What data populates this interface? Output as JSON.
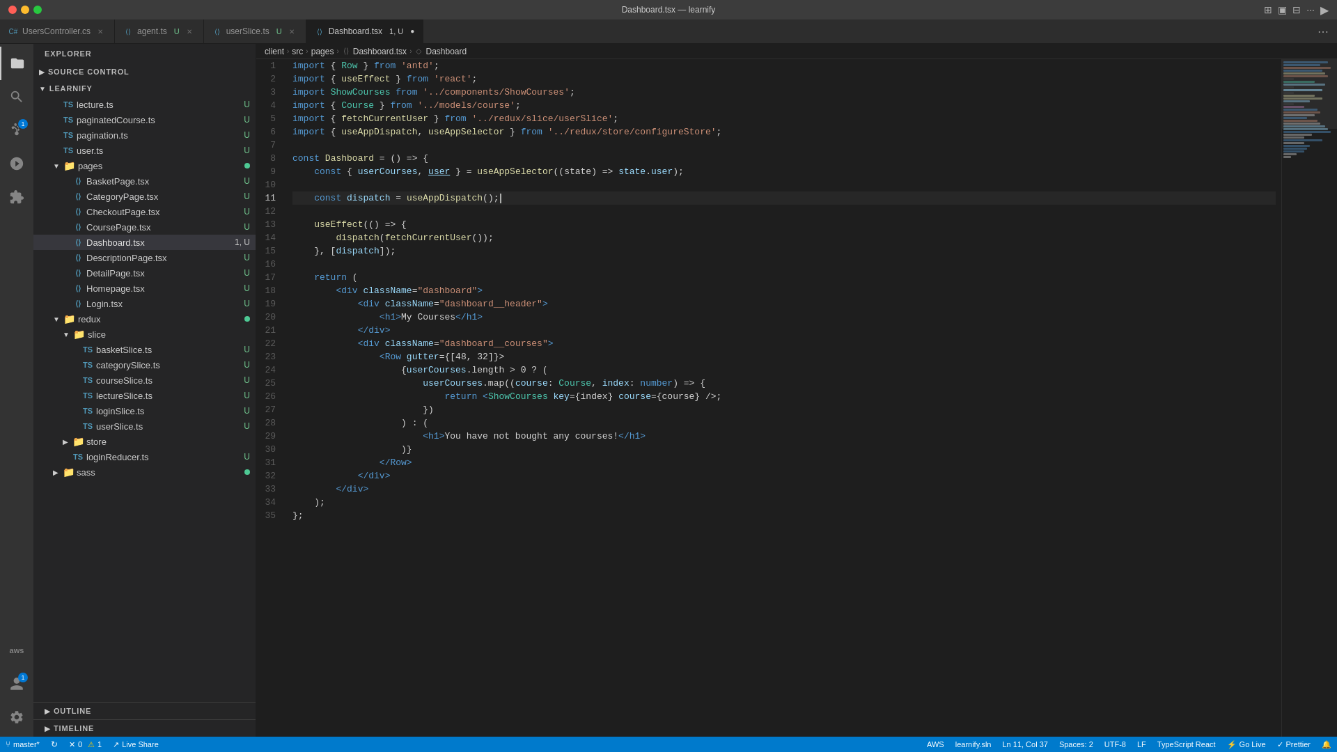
{
  "titlebar": {
    "title": "Dashboard.tsx — learnify",
    "buttons": {
      "close": "●",
      "min": "●",
      "max": "●"
    }
  },
  "tabs": [
    {
      "id": "users-controller",
      "label": "UsersController.cs",
      "icon": "C#",
      "iconColor": "blue",
      "modified": false,
      "active": false
    },
    {
      "id": "agent-ts",
      "label": "agent.ts",
      "icon": "TS",
      "iconColor": "blue",
      "modified": true,
      "badge": "U",
      "active": false
    },
    {
      "id": "user-slice-ts",
      "label": "userSlice.ts",
      "icon": "TS",
      "iconColor": "blue",
      "modified": true,
      "badge": "U",
      "active": false
    },
    {
      "id": "dashboard-tsx",
      "label": "Dashboard.tsx",
      "icon": "TSX",
      "iconColor": "blue",
      "modified": true,
      "badge": "1, U",
      "active": true
    }
  ],
  "breadcrumb": {
    "items": [
      "client",
      "src",
      "pages",
      "Dashboard.tsx",
      "Dashboard"
    ]
  },
  "sidebar": {
    "title": "EXPLORER",
    "sections": {
      "sourceControl": {
        "label": "SOURCE CONTROL",
        "expanded": false
      },
      "learnify": {
        "label": "LEARNIFY",
        "expanded": true
      }
    },
    "files": [
      {
        "name": "lecture.ts",
        "indent": 2,
        "modified": "U",
        "type": "ts"
      },
      {
        "name": "paginatedCourse.ts",
        "indent": 2,
        "modified": "U",
        "type": "ts"
      },
      {
        "name": "pagination.ts",
        "indent": 2,
        "modified": "U",
        "type": "ts"
      },
      {
        "name": "user.ts",
        "indent": 2,
        "modified": "U",
        "type": "ts"
      },
      {
        "name": "pages",
        "indent": 1,
        "type": "folder",
        "expanded": true,
        "dotColor": true
      },
      {
        "name": "BasketPage.tsx",
        "indent": 3,
        "modified": "U",
        "type": "ts"
      },
      {
        "name": "CategoryPage.tsx",
        "indent": 3,
        "modified": "U",
        "type": "ts"
      },
      {
        "name": "CheckoutPage.tsx",
        "indent": 3,
        "modified": "U",
        "type": "ts"
      },
      {
        "name": "CoursePage.tsx",
        "indent": 3,
        "modified": "U",
        "type": "ts"
      },
      {
        "name": "Dashboard.tsx",
        "indent": 3,
        "modified": "1, U",
        "type": "ts",
        "active": true
      },
      {
        "name": "DescriptionPage.tsx",
        "indent": 3,
        "modified": "U",
        "type": "ts"
      },
      {
        "name": "DetailPage.tsx",
        "indent": 3,
        "modified": "U",
        "type": "ts"
      },
      {
        "name": "Homepage.tsx",
        "indent": 3,
        "modified": "U",
        "type": "ts"
      },
      {
        "name": "Login.tsx",
        "indent": 3,
        "modified": "U",
        "type": "ts"
      },
      {
        "name": "redux",
        "indent": 1,
        "type": "folder",
        "expanded": true,
        "dotColor": true
      },
      {
        "name": "slice",
        "indent": 2,
        "type": "folder",
        "expanded": true
      },
      {
        "name": "basketSlice.ts",
        "indent": 4,
        "modified": "U",
        "type": "ts"
      },
      {
        "name": "categorySlice.ts",
        "indent": 4,
        "modified": "U",
        "type": "ts"
      },
      {
        "name": "courseSlice.ts",
        "indent": 4,
        "modified": "U",
        "type": "ts"
      },
      {
        "name": "lectureSlice.ts",
        "indent": 4,
        "modified": "U",
        "type": "ts"
      },
      {
        "name": "loginSlice.ts",
        "indent": 4,
        "modified": "U",
        "type": "ts"
      },
      {
        "name": "userSlice.ts",
        "indent": 4,
        "modified": "U",
        "type": "ts"
      },
      {
        "name": "store",
        "indent": 2,
        "type": "folder",
        "expanded": false
      },
      {
        "name": "loginReducer.ts",
        "indent": 3,
        "modified": "U",
        "type": "ts"
      },
      {
        "name": "sass",
        "indent": 1,
        "type": "folder",
        "expanded": false,
        "dotColor": true
      }
    ],
    "outline": {
      "label": "OUTLINE",
      "expanded": false
    },
    "timeline": {
      "label": "TIMELINE",
      "expanded": false
    }
  },
  "editor": {
    "filename": "Dashboard.tsx",
    "lines": [
      {
        "num": 1,
        "tokens": [
          {
            "t": "import",
            "c": "kw"
          },
          {
            "t": " { ",
            "c": "plain"
          },
          {
            "t": "Row",
            "c": "cls"
          },
          {
            "t": " } ",
            "c": "plain"
          },
          {
            "t": "from",
            "c": "kw"
          },
          {
            "t": " ",
            "c": "plain"
          },
          {
            "t": "'antd'",
            "c": "str"
          },
          {
            "t": ";",
            "c": "punc"
          }
        ]
      },
      {
        "num": 2,
        "tokens": [
          {
            "t": "import",
            "c": "kw"
          },
          {
            "t": " { ",
            "c": "plain"
          },
          {
            "t": "useEffect",
            "c": "fn"
          },
          {
            "t": " } ",
            "c": "plain"
          },
          {
            "t": "from",
            "c": "kw"
          },
          {
            "t": " ",
            "c": "plain"
          },
          {
            "t": "'react'",
            "c": "str"
          },
          {
            "t": ";",
            "c": "punc"
          }
        ]
      },
      {
        "num": 3,
        "tokens": [
          {
            "t": "import",
            "c": "kw"
          },
          {
            "t": " ",
            "c": "plain"
          },
          {
            "t": "ShowCourses",
            "c": "cls"
          },
          {
            "t": " ",
            "c": "plain"
          },
          {
            "t": "from",
            "c": "kw"
          },
          {
            "t": " ",
            "c": "plain"
          },
          {
            "t": "'../components/ShowCourses'",
            "c": "str"
          },
          {
            "t": ";",
            "c": "punc"
          }
        ]
      },
      {
        "num": 4,
        "tokens": [
          {
            "t": "import",
            "c": "kw"
          },
          {
            "t": " { ",
            "c": "plain"
          },
          {
            "t": "Course",
            "c": "cls"
          },
          {
            "t": " } ",
            "c": "plain"
          },
          {
            "t": "from",
            "c": "kw"
          },
          {
            "t": " ",
            "c": "plain"
          },
          {
            "t": "'../models/course'",
            "c": "str"
          },
          {
            "t": ";",
            "c": "punc"
          }
        ]
      },
      {
        "num": 5,
        "tokens": [
          {
            "t": "import",
            "c": "kw"
          },
          {
            "t": " { ",
            "c": "plain"
          },
          {
            "t": "fetchCurrentUser",
            "c": "fn"
          },
          {
            "t": " } ",
            "c": "plain"
          },
          {
            "t": "from",
            "c": "kw"
          },
          {
            "t": " ",
            "c": "plain"
          },
          {
            "t": "'../redux/slice/userSlice'",
            "c": "str"
          },
          {
            "t": ";",
            "c": "punc"
          }
        ]
      },
      {
        "num": 6,
        "tokens": [
          {
            "t": "import",
            "c": "kw"
          },
          {
            "t": " { ",
            "c": "plain"
          },
          {
            "t": "useAppDispatch",
            "c": "fn"
          },
          {
            "t": ", ",
            "c": "plain"
          },
          {
            "t": "useAppSelector",
            "c": "fn"
          },
          {
            "t": " } ",
            "c": "plain"
          },
          {
            "t": "from",
            "c": "kw"
          },
          {
            "t": " ",
            "c": "plain"
          },
          {
            "t": "'../redux/store/configureStore'",
            "c": "str"
          },
          {
            "t": ";",
            "c": "punc"
          }
        ]
      },
      {
        "num": 7,
        "tokens": []
      },
      {
        "num": 8,
        "tokens": [
          {
            "t": "const",
            "c": "kw"
          },
          {
            "t": " ",
            "c": "plain"
          },
          {
            "t": "Dashboard",
            "c": "fn"
          },
          {
            "t": " = () => {",
            "c": "plain"
          }
        ]
      },
      {
        "num": 9,
        "tokens": [
          {
            "t": "    ",
            "c": "plain"
          },
          {
            "t": "const",
            "c": "kw"
          },
          {
            "t": " { ",
            "c": "plain"
          },
          {
            "t": "userCourses",
            "c": "var"
          },
          {
            "t": ", ",
            "c": "plain"
          },
          {
            "t": "user",
            "c": "var underline"
          },
          {
            "t": " } = ",
            "c": "plain"
          },
          {
            "t": "useAppSelector",
            "c": "fn"
          },
          {
            "t": "((state) => ",
            "c": "plain"
          },
          {
            "t": "state",
            "c": "var"
          },
          {
            "t": ".",
            "c": "plain"
          },
          {
            "t": "user",
            "c": "var"
          },
          {
            "t": ");",
            "c": "punc"
          }
        ]
      },
      {
        "num": 10,
        "tokens": []
      },
      {
        "num": 11,
        "tokens": [
          {
            "t": "    ",
            "c": "plain"
          },
          {
            "t": "const",
            "c": "kw"
          },
          {
            "t": " ",
            "c": "plain"
          },
          {
            "t": "dispatch",
            "c": "var"
          },
          {
            "t": " = ",
            "c": "plain"
          },
          {
            "t": "useAppDispatch",
            "c": "fn"
          },
          {
            "t": "();",
            "c": "punc"
          }
        ],
        "active": true
      },
      {
        "num": 12,
        "tokens": []
      },
      {
        "num": 13,
        "tokens": [
          {
            "t": "    ",
            "c": "plain"
          },
          {
            "t": "useEffect",
            "c": "fn"
          },
          {
            "t": "(() => {",
            "c": "plain"
          }
        ]
      },
      {
        "num": 14,
        "tokens": [
          {
            "t": "        ",
            "c": "plain"
          },
          {
            "t": "dispatch",
            "c": "fn"
          },
          {
            "t": "(",
            "c": "plain"
          },
          {
            "t": "fetchCurrentUser",
            "c": "fn"
          },
          {
            "t": "());",
            "c": "punc"
          }
        ]
      },
      {
        "num": 15,
        "tokens": [
          {
            "t": "    }, [",
            "c": "plain"
          },
          {
            "t": "dispatch",
            "c": "var"
          },
          {
            "t": "]);",
            "c": "punc"
          }
        ]
      },
      {
        "num": 16,
        "tokens": []
      },
      {
        "num": 17,
        "tokens": [
          {
            "t": "    ",
            "c": "plain"
          },
          {
            "t": "return",
            "c": "kw"
          },
          {
            "t": " (",
            "c": "punc"
          }
        ]
      },
      {
        "num": 18,
        "tokens": [
          {
            "t": "        ",
            "c": "plain"
          },
          {
            "t": "<div",
            "c": "kw"
          },
          {
            "t": " ",
            "c": "plain"
          },
          {
            "t": "className",
            "c": "attr"
          },
          {
            "t": "=",
            "c": "plain"
          },
          {
            "t": "\"dashboard\"",
            "c": "str"
          },
          {
            "t": ">",
            "c": "kw"
          }
        ]
      },
      {
        "num": 19,
        "tokens": [
          {
            "t": "            ",
            "c": "plain"
          },
          {
            "t": "<div",
            "c": "kw"
          },
          {
            "t": " ",
            "c": "plain"
          },
          {
            "t": "className",
            "c": "attr"
          },
          {
            "t": "=",
            "c": "plain"
          },
          {
            "t": "\"dashboard__header\"",
            "c": "str"
          },
          {
            "t": ">",
            "c": "kw"
          }
        ]
      },
      {
        "num": 20,
        "tokens": [
          {
            "t": "                ",
            "c": "plain"
          },
          {
            "t": "<h1",
            "c": "kw"
          },
          {
            "t": ">My Courses</",
            "c": "plain"
          },
          {
            "t": "h1",
            "c": "kw"
          },
          {
            "t": ">",
            "c": "kw"
          }
        ]
      },
      {
        "num": 21,
        "tokens": [
          {
            "t": "            </div>",
            "c": "kw"
          }
        ]
      },
      {
        "num": 22,
        "tokens": [
          {
            "t": "            ",
            "c": "plain"
          },
          {
            "t": "<div",
            "c": "kw"
          },
          {
            "t": " ",
            "c": "plain"
          },
          {
            "t": "className",
            "c": "attr"
          },
          {
            "t": "=",
            "c": "plain"
          },
          {
            "t": "\"dashboard__courses\"",
            "c": "str"
          },
          {
            "t": ">",
            "c": "kw"
          }
        ]
      },
      {
        "num": 23,
        "tokens": [
          {
            "t": "                ",
            "c": "plain"
          },
          {
            "t": "<Row",
            "c": "kw"
          },
          {
            "t": " ",
            "c": "plain"
          },
          {
            "t": "gutter",
            "c": "attr"
          },
          {
            "t": "={[48, 32]}>",
            "c": "plain"
          }
        ]
      },
      {
        "num": 24,
        "tokens": [
          {
            "t": "                    ",
            "c": "plain"
          },
          {
            "t": "{userCourses.length > 0 ? (",
            "c": "plain"
          }
        ]
      },
      {
        "num": 25,
        "tokens": [
          {
            "t": "                        ",
            "c": "plain"
          },
          {
            "t": "userCourses",
            "c": "var"
          },
          {
            "t": ".map((",
            "c": "plain"
          },
          {
            "t": "course",
            "c": "var"
          },
          {
            "t": ": ",
            "c": "plain"
          },
          {
            "t": "Course",
            "c": "cls"
          },
          {
            "t": ", ",
            "c": "plain"
          },
          {
            "t": "index",
            "c": "var"
          },
          {
            "t": ": ",
            "c": "plain"
          },
          {
            "t": "number",
            "c": "kw"
          },
          {
            "t": ") => {",
            "c": "plain"
          }
        ]
      },
      {
        "num": 26,
        "tokens": [
          {
            "t": "                            ",
            "c": "plain"
          },
          {
            "t": "return",
            "c": "kw"
          },
          {
            "t": " ",
            "c": "plain"
          },
          {
            "t": "<ShowCourses",
            "c": "cls"
          },
          {
            "t": " ",
            "c": "plain"
          },
          {
            "t": "key",
            "c": "attr"
          },
          {
            "t": "={index} ",
            "c": "plain"
          },
          {
            "t": "course",
            "c": "attr"
          },
          {
            "t": "={course} />;",
            "c": "plain"
          }
        ]
      },
      {
        "num": 27,
        "tokens": [
          {
            "t": "                        })",
            "c": "plain"
          }
        ]
      },
      {
        "num": 28,
        "tokens": [
          {
            "t": "                    ) : (",
            "c": "plain"
          }
        ]
      },
      {
        "num": 29,
        "tokens": [
          {
            "t": "                        ",
            "c": "plain"
          },
          {
            "t": "<h1",
            "c": "kw"
          },
          {
            "t": ">You have not bought any courses!</",
            "c": "plain"
          },
          {
            "t": "h1",
            "c": "kw"
          },
          {
            "t": ">",
            "c": "kw"
          }
        ]
      },
      {
        "num": 30,
        "tokens": [
          {
            "t": "                    )}",
            "c": "plain"
          }
        ]
      },
      {
        "num": 31,
        "tokens": [
          {
            "t": "                </Row>",
            "c": "kw"
          }
        ]
      },
      {
        "num": 32,
        "tokens": [
          {
            "t": "            </div>",
            "c": "kw"
          }
        ]
      },
      {
        "num": 33,
        "tokens": [
          {
            "t": "        </div>",
            "c": "kw"
          }
        ]
      },
      {
        "num": 34,
        "tokens": [
          {
            "t": "    );",
            "c": "punc"
          }
        ]
      },
      {
        "num": 35,
        "tokens": [
          {
            "t": "};",
            "c": "punc"
          }
        ]
      }
    ]
  },
  "statusbar": {
    "branch": "master*",
    "sync": "⟳",
    "errors": "0",
    "warnings": "1",
    "liveshare": "Live Share",
    "aws": "AWS",
    "solution": "learnify.sln",
    "position": "Ln 11, Col 37",
    "spaces": "Spaces: 2",
    "encoding": "UTF-8",
    "lineending": "LF",
    "language": "TypeScript React",
    "golive": "Go Live",
    "prettier": "Prettier"
  }
}
